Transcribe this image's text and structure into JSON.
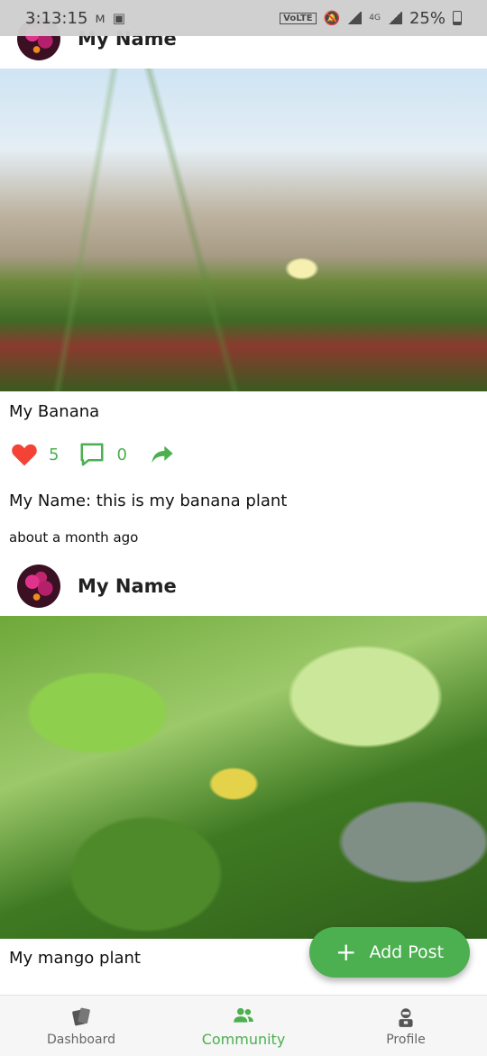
{
  "status_bar": {
    "time": "3:13:15",
    "network": "VoLTE",
    "lte": "4G",
    "battery": "25%",
    "icons": [
      "maps-m-icon",
      "image-icon",
      "mute-bell-icon",
      "signal-icon",
      "battery-icon"
    ]
  },
  "posts": [
    {
      "author": "My Name",
      "photo": "ice-plant-flower-photo",
      "title": "My Banana",
      "likes": "5",
      "comments": "0",
      "description": "My Name: this is my banana plant",
      "time": "about a month ago"
    },
    {
      "author": "My Name",
      "photo": "leafy-plant-photo",
      "title": "My mango plant"
    }
  ],
  "fab": {
    "label": "Add Post",
    "icon": "plus-icon"
  },
  "bottom_nav": {
    "items": [
      {
        "label": "Dashboard",
        "icon": "dashboard-cards-icon"
      },
      {
        "label": "Community",
        "icon": "people-icon",
        "active": true
      },
      {
        "label": "Profile",
        "icon": "profile-robot-icon"
      }
    ]
  },
  "colors": {
    "accent": "#4caf50",
    "like": "#f44336",
    "status_bar": "#cfcfcf"
  }
}
